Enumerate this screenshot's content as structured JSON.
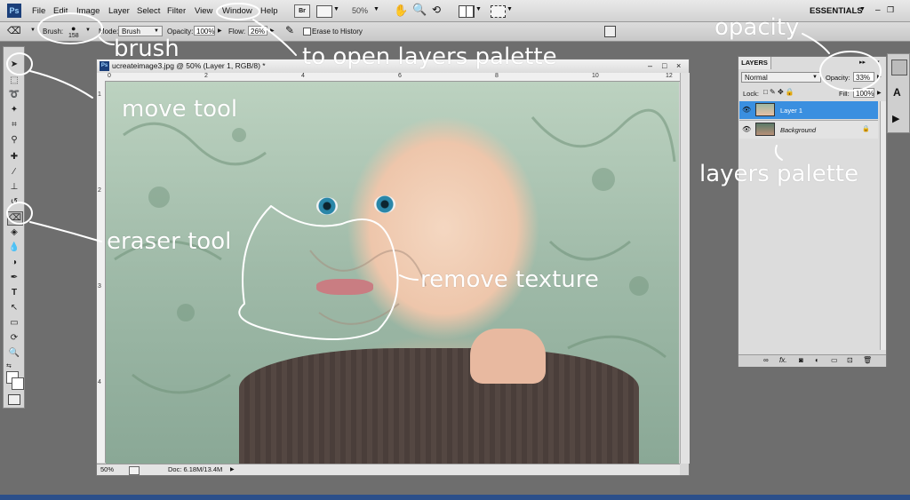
{
  "app": {
    "logo": "Ps"
  },
  "menu": [
    "File",
    "Edit",
    "Image",
    "Layer",
    "Select",
    "Filter",
    "View",
    "Window",
    "Help"
  ],
  "menubar": {
    "br_label": "Br",
    "zoom": "50%",
    "workspace": "ESSENTIALS",
    "minimize": "–",
    "restore": "❐"
  },
  "options": {
    "brush_label": "Brush:",
    "brush_size": "158",
    "mode_label": "Mode:",
    "mode_value": "Brush",
    "opacity_label": "Opacity:",
    "opacity_value": "100%",
    "flow_label": "Flow:",
    "flow_value": "26%",
    "erase_history": "Erase to History"
  },
  "document": {
    "title": "ucreateimage3.jpg @ 50% (Layer 1, RGB/8) *",
    "zoom": "50%",
    "doc_info": "Doc: 6.18M/13.4M",
    "ruler_h": [
      "0",
      "2",
      "4",
      "6",
      "8",
      "10",
      "12"
    ],
    "ruler_v": [
      "1",
      "2",
      "3",
      "4"
    ]
  },
  "layers_panel": {
    "tab": "LAYERS",
    "blend_mode": "Normal",
    "opacity_label": "Opacity:",
    "opacity_value": "33%",
    "lock_label": "Lock:",
    "fill_label": "Fill:",
    "fill_value": "100%",
    "layers": [
      {
        "name": "Layer 1",
        "selected": true
      },
      {
        "name": "Background",
        "selected": false,
        "locked": true
      }
    ]
  },
  "annotations": {
    "brush": "brush",
    "window": "to open layers palette",
    "opacity": "opacity",
    "move_tool": "move tool",
    "eraser_tool": "eraser tool",
    "remove_texture": "remove texture",
    "layers_palette": "layers palette"
  },
  "colors": {
    "selected_layer": "#3a8fe0",
    "menubar": "#dedede",
    "background": "#6e6e6e"
  }
}
